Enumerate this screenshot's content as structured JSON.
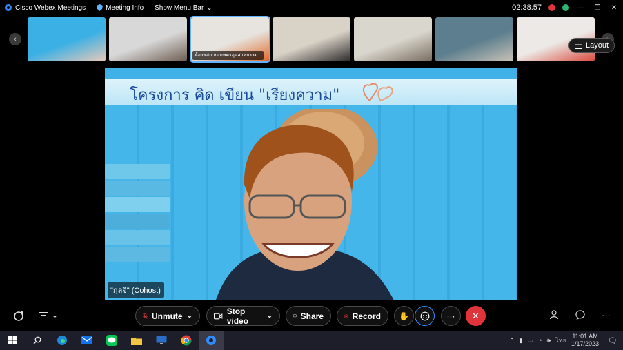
{
  "titlebar": {
    "app_title": "Cisco Webex Meetings",
    "meeting_info": "Meeting Info",
    "show_menu_bar": "Show Menu Bar",
    "timer": "02:38:57"
  },
  "thumbnails": [
    {
      "label": "",
      "colors": [
        "#3bb0e5",
        "#e9c9b8"
      ]
    },
    {
      "label": "",
      "colors": [
        "#d8d8d8",
        "#6e5d52"
      ]
    },
    {
      "label": "ห้องพสถานเกษตรอุตสาหกรรม...",
      "colors": [
        "#e7e4df",
        "#e06a2c"
      ],
      "active": true
    },
    {
      "label": "",
      "colors": [
        "#d9d2c7",
        "#2d2a2a"
      ]
    },
    {
      "label": "",
      "colors": [
        "#d9d6cd",
        "#7a6d60"
      ]
    },
    {
      "label": "",
      "colors": [
        "#5c7e8e",
        "#c9c2b6"
      ]
    },
    {
      "label": "",
      "colors": [
        "#ece9e6",
        "#d94b3d"
      ]
    }
  ],
  "layout_button": "Layout",
  "main_video": {
    "banner_text": "โครงการ คิด เขียน \"เรียงความ\"",
    "name_tag": "\"กุลจี\" (Cohost)"
  },
  "controls": {
    "unmute": "Unmute",
    "stop_video": "Stop video",
    "share": "Share",
    "record": "Record"
  },
  "taskbar": {
    "language": "ไทย",
    "time": "11:01 AM",
    "date": "1/17/2023"
  },
  "colors": {
    "accent": "#2f8cff",
    "end_call": "#e0343c",
    "record_dot": "#e0343c",
    "main_bg": "#3fb1e6"
  }
}
